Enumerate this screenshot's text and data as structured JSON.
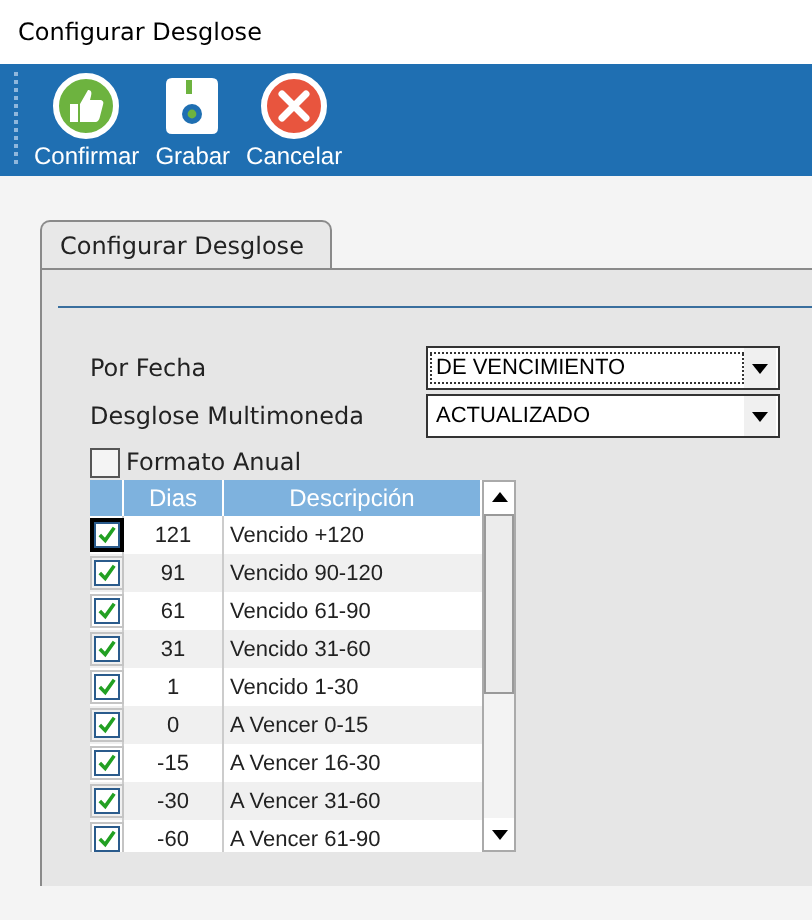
{
  "window": {
    "title": "Configurar Desglose"
  },
  "toolbar": [
    {
      "kind": "confirm",
      "label": "Confirmar"
    },
    {
      "kind": "save",
      "label": "Grabar"
    },
    {
      "kind": "cancel",
      "label": "Cancelar"
    }
  ],
  "tabs": [
    {
      "label": "Configurar Desglose",
      "selected": true
    }
  ],
  "fields": [
    {
      "label": "Por Fecha",
      "value": "DE VENCIMIENTO",
      "focused": true
    },
    {
      "label": "Desglose Multimoneda",
      "value": "ACTUALIZADO",
      "focused": false
    }
  ],
  "formato_anual": {
    "label": "Formato Anual",
    "checked": false
  },
  "table": {
    "columns": [
      "Dias",
      "Descripción"
    ],
    "rows": [
      {
        "checked": true,
        "selected": true,
        "dias": "121",
        "descripcion": "Vencido +120"
      },
      {
        "checked": true,
        "selected": false,
        "dias": "91",
        "descripcion": "Vencido 90-120"
      },
      {
        "checked": true,
        "selected": false,
        "dias": "61",
        "descripcion": "Vencido 61-90"
      },
      {
        "checked": true,
        "selected": false,
        "dias": "31",
        "descripcion": "Vencido 31-60"
      },
      {
        "checked": true,
        "selected": false,
        "dias": "1",
        "descripcion": "Vencido 1-30"
      },
      {
        "checked": true,
        "selected": false,
        "dias": "0",
        "descripcion": "A Vencer 0-15"
      },
      {
        "checked": true,
        "selected": false,
        "dias": "-15",
        "descripcion": "A Vencer 16-30"
      },
      {
        "checked": true,
        "selected": false,
        "dias": "-30",
        "descripcion": "A Vencer 31-60"
      },
      {
        "checked": true,
        "selected": false,
        "dias": "-60",
        "descripcion": "A Vencer 61-90"
      }
    ]
  }
}
